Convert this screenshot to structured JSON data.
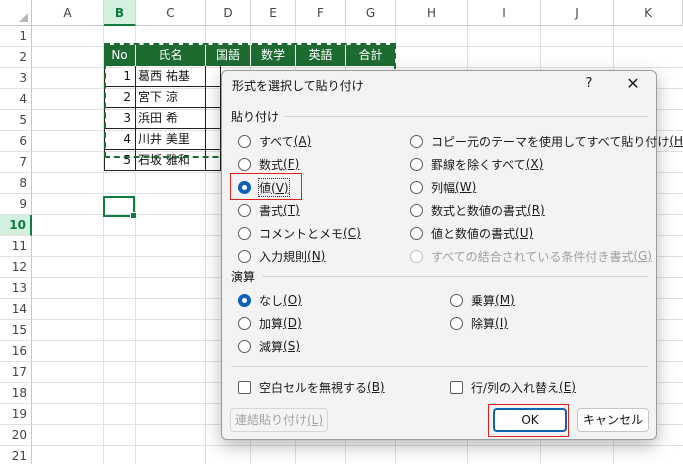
{
  "sheet": {
    "columns": [
      "A",
      "B",
      "C",
      "D",
      "E",
      "F",
      "G",
      "H",
      "I",
      "J",
      "K"
    ],
    "rows": [
      "1",
      "2",
      "3",
      "4",
      "5",
      "6",
      "7",
      "8",
      "9",
      "10",
      "11",
      "12",
      "13",
      "14",
      "15",
      "16",
      "17",
      "18",
      "19",
      "20",
      "21"
    ],
    "selected_column": "B",
    "selected_row": "10",
    "table": {
      "headers": [
        "No",
        "氏名",
        "国語",
        "数学",
        "英語",
        "合計"
      ],
      "records": [
        {
          "no": "1",
          "name": "葛西 祐基"
        },
        {
          "no": "2",
          "name": "宮下 涼"
        },
        {
          "no": "3",
          "name": "浜田 希"
        },
        {
          "no": "4",
          "name": "川井 美里"
        },
        {
          "no": "5",
          "name": "石坂 雅和"
        }
      ]
    }
  },
  "dialog": {
    "title": "形式を選択して貼り付け",
    "help_label": "?",
    "close_label": "✕",
    "paste_section": "貼り付け",
    "paste_options": [
      {
        "label": "すべて",
        "key": "(A)",
        "checked": false,
        "disabled": false
      },
      {
        "label": "数式",
        "key": "(F)",
        "checked": false,
        "disabled": false
      },
      {
        "label": "値",
        "key": "(V)",
        "checked": true,
        "disabled": false
      },
      {
        "label": "書式",
        "key": "(T)",
        "checked": false,
        "disabled": false
      },
      {
        "label": "コメントとメモ",
        "key": "(C)",
        "checked": false,
        "disabled": false
      },
      {
        "label": "入力規則",
        "key": "(N)",
        "checked": false,
        "disabled": false
      },
      {
        "label": "コピー元のテーマを使用してすべて貼り付け",
        "key": "(H)",
        "checked": false,
        "disabled": false
      },
      {
        "label": "罫線を除くすべて",
        "key": "(X)",
        "checked": false,
        "disabled": false
      },
      {
        "label": "列幅",
        "key": "(W)",
        "checked": false,
        "disabled": false
      },
      {
        "label": "数式と数値の書式",
        "key": "(R)",
        "checked": false,
        "disabled": false
      },
      {
        "label": "値と数値の書式",
        "key": "(U)",
        "checked": false,
        "disabled": false
      },
      {
        "label": "すべての結合されている条件付き書式",
        "key": "(G)",
        "checked": false,
        "disabled": true
      }
    ],
    "operation_section": "演算",
    "operation_options": [
      {
        "label": "なし",
        "key": "(O)",
        "checked": true
      },
      {
        "label": "加算",
        "key": "(D)",
        "checked": false
      },
      {
        "label": "減算",
        "key": "(S)",
        "checked": false
      },
      {
        "label": "乗算",
        "key": "(M)",
        "checked": false
      },
      {
        "label": "除算",
        "key": "(I)",
        "checked": false
      }
    ],
    "skip_blanks": {
      "label": "空白セルを無視する",
      "key": "(B)",
      "checked": false
    },
    "transpose": {
      "label": "行/列の入れ替え",
      "key": "(E)",
      "checked": false
    },
    "paste_link_button": {
      "label": "連結貼り付け",
      "key": "(L)"
    },
    "ok_button": "OK",
    "cancel_button": "キャンセル",
    "highlight_color": "#e0201b",
    "accent_color": "#0f60b6"
  }
}
